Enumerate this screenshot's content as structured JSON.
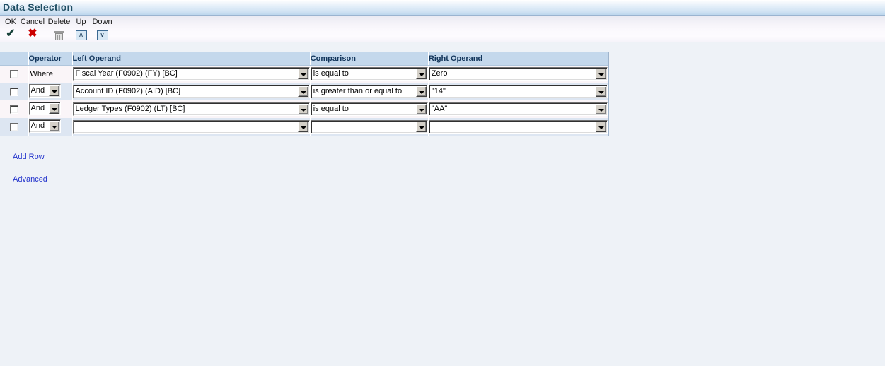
{
  "window": {
    "title": "Data Selection"
  },
  "toolbar": {
    "items": [
      {
        "label_pre": "O",
        "label_accel": "K",
        "label_post": "",
        "name": "ok",
        "icon": "check-icon"
      },
      {
        "label_pre": "Cance",
        "label_accel": "l",
        "label_post": "",
        "name": "cancel",
        "icon": "x-icon"
      },
      {
        "label_pre": "",
        "label_accel": "D",
        "label_post": "elete",
        "name": "delete",
        "icon": "trash-icon"
      },
      {
        "label_pre": "Up",
        "label_accel": "",
        "label_post": "",
        "name": "up",
        "icon": "chevron-up-icon"
      },
      {
        "label_pre": "Down",
        "label_accel": "",
        "label_post": "",
        "name": "down",
        "icon": "chevron-down-icon"
      }
    ],
    "ok_label": "OK",
    "cancel_label": "Cancel",
    "delete_label": "Delete",
    "up_label": "Up",
    "down_label": "Down",
    "up_glyph": "∧",
    "down_glyph": "∨",
    "check_glyph": "✔",
    "x_glyph": "✖"
  },
  "grid": {
    "headers": {
      "checkbox": "",
      "operator": "Operator",
      "left_operand": "Left Operand",
      "comparison": "Comparison",
      "right_operand": "Right Operand"
    },
    "rows": [
      {
        "checked": false,
        "operator": "Where",
        "operator_is_dropdown": false,
        "left_operand": "Fiscal Year (F0902) (FY) [BC]",
        "comparison": "is equal to",
        "right_operand": "Zero"
      },
      {
        "checked": false,
        "operator": "And",
        "operator_is_dropdown": true,
        "left_operand": "Account ID (F0902) (AID) [BC]",
        "comparison": "is greater than or equal to",
        "right_operand": "\"14\""
      },
      {
        "checked": false,
        "operator": "And",
        "operator_is_dropdown": true,
        "left_operand": "Ledger Types (F0902) (LT) [BC]",
        "comparison": "is equal to",
        "right_operand": "\"AA\""
      },
      {
        "checked": false,
        "operator": "And",
        "operator_is_dropdown": true,
        "left_operand": "",
        "comparison": "",
        "right_operand": ""
      }
    ]
  },
  "links": {
    "add_row": "Add Row",
    "advanced": "Advanced"
  },
  "colors": {
    "title_text": "#1f4e63",
    "header_bg": "#c4d8ec",
    "header_text": "#12355b",
    "row_odd_bg": "#faf5f8",
    "row_even_bg": "#dde6f2",
    "page_bg": "#eef2f7",
    "link": "#2233cc",
    "ok_check": "#19443b",
    "cancel_x": "#cc0000"
  }
}
